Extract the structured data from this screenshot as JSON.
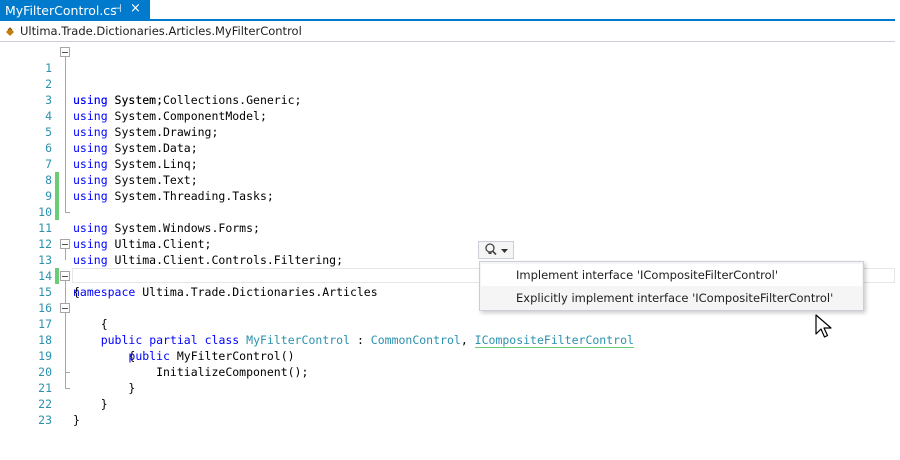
{
  "tab": {
    "title": "MyFilterControl.cs",
    "pin_glyph": "⊣",
    "close_glyph": "×"
  },
  "navbar": {
    "type_path": "Ultima.Trade.Dictionaries.Articles.MyFilterControl"
  },
  "editor": {
    "lines": [
      {
        "num": "1",
        "text": "using System;"
      },
      {
        "num": "2",
        "text": "using System.Collections.Generic;"
      },
      {
        "num": "3",
        "text": "using System.ComponentModel;"
      },
      {
        "num": "4",
        "text": "using System.Drawing;"
      },
      {
        "num": "5",
        "text": "using System.Data;"
      },
      {
        "num": "6",
        "text": "using System.Linq;"
      },
      {
        "num": "7",
        "text": "using System.Text;"
      },
      {
        "num": "8",
        "text": "using System.Threading.Tasks;"
      },
      {
        "num": "9",
        "text": "using System.Windows.Forms;"
      },
      {
        "num": "10",
        "text": "using Ultima.Client;"
      },
      {
        "num": "11",
        "text": "using Ultima.Client.Controls.Filtering;"
      },
      {
        "num": "12",
        "text": ""
      },
      {
        "num": "13",
        "text": "namespace Ultima.Trade.Dictionaries.Articles"
      },
      {
        "num": "14",
        "text": "{"
      },
      {
        "num": "15",
        "text": "    public partial class MyFilterControl : CommonControl, ICompositeFilterControl"
      },
      {
        "num": "16",
        "text": "    {"
      },
      {
        "num": "17",
        "text": "        public MyFilterControl()"
      },
      {
        "num": "18",
        "text": "        {"
      },
      {
        "num": "19",
        "text": "            InitializeComponent();"
      },
      {
        "num": "20",
        "text": "        }"
      },
      {
        "num": "21",
        "text": "    }"
      },
      {
        "num": "22",
        "text": "}"
      },
      {
        "num": "23",
        "text": ""
      }
    ]
  },
  "quick_actions": {
    "items": [
      {
        "label": "Implement interface 'ICompositeFilterControl'"
      },
      {
        "label": "Explicitly implement interface 'ICompositeFilterControl'"
      }
    ]
  },
  "colors": {
    "accent": "#007acc",
    "keyword": "#0000ff",
    "type": "#2b91af",
    "changed": "#6acc74"
  }
}
